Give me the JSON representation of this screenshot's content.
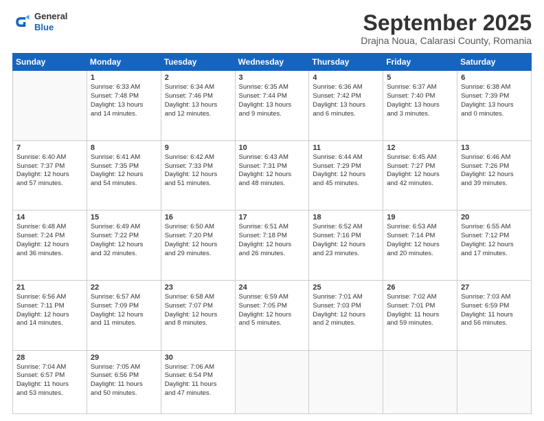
{
  "header": {
    "logo_general": "General",
    "logo_blue": "Blue",
    "month_title": "September 2025",
    "location": "Drajna Noua, Calarasi County, Romania"
  },
  "weekdays": [
    "Sunday",
    "Monday",
    "Tuesday",
    "Wednesday",
    "Thursday",
    "Friday",
    "Saturday"
  ],
  "weeks": [
    [
      {
        "day": "",
        "content": ""
      },
      {
        "day": "1",
        "content": "Sunrise: 6:33 AM\nSunset: 7:48 PM\nDaylight: 13 hours\nand 14 minutes."
      },
      {
        "day": "2",
        "content": "Sunrise: 6:34 AM\nSunset: 7:46 PM\nDaylight: 13 hours\nand 12 minutes."
      },
      {
        "day": "3",
        "content": "Sunrise: 6:35 AM\nSunset: 7:44 PM\nDaylight: 13 hours\nand 9 minutes."
      },
      {
        "day": "4",
        "content": "Sunrise: 6:36 AM\nSunset: 7:42 PM\nDaylight: 13 hours\nand 6 minutes."
      },
      {
        "day": "5",
        "content": "Sunrise: 6:37 AM\nSunset: 7:40 PM\nDaylight: 13 hours\nand 3 minutes."
      },
      {
        "day": "6",
        "content": "Sunrise: 6:38 AM\nSunset: 7:39 PM\nDaylight: 13 hours\nand 0 minutes."
      }
    ],
    [
      {
        "day": "7",
        "content": "Sunrise: 6:40 AM\nSunset: 7:37 PM\nDaylight: 12 hours\nand 57 minutes."
      },
      {
        "day": "8",
        "content": "Sunrise: 6:41 AM\nSunset: 7:35 PM\nDaylight: 12 hours\nand 54 minutes."
      },
      {
        "day": "9",
        "content": "Sunrise: 6:42 AM\nSunset: 7:33 PM\nDaylight: 12 hours\nand 51 minutes."
      },
      {
        "day": "10",
        "content": "Sunrise: 6:43 AM\nSunset: 7:31 PM\nDaylight: 12 hours\nand 48 minutes."
      },
      {
        "day": "11",
        "content": "Sunrise: 6:44 AM\nSunset: 7:29 PM\nDaylight: 12 hours\nand 45 minutes."
      },
      {
        "day": "12",
        "content": "Sunrise: 6:45 AM\nSunset: 7:27 PM\nDaylight: 12 hours\nand 42 minutes."
      },
      {
        "day": "13",
        "content": "Sunrise: 6:46 AM\nSunset: 7:26 PM\nDaylight: 12 hours\nand 39 minutes."
      }
    ],
    [
      {
        "day": "14",
        "content": "Sunrise: 6:48 AM\nSunset: 7:24 PM\nDaylight: 12 hours\nand 36 minutes."
      },
      {
        "day": "15",
        "content": "Sunrise: 6:49 AM\nSunset: 7:22 PM\nDaylight: 12 hours\nand 32 minutes."
      },
      {
        "day": "16",
        "content": "Sunrise: 6:50 AM\nSunset: 7:20 PM\nDaylight: 12 hours\nand 29 minutes."
      },
      {
        "day": "17",
        "content": "Sunrise: 6:51 AM\nSunset: 7:18 PM\nDaylight: 12 hours\nand 26 minutes."
      },
      {
        "day": "18",
        "content": "Sunrise: 6:52 AM\nSunset: 7:16 PM\nDaylight: 12 hours\nand 23 minutes."
      },
      {
        "day": "19",
        "content": "Sunrise: 6:53 AM\nSunset: 7:14 PM\nDaylight: 12 hours\nand 20 minutes."
      },
      {
        "day": "20",
        "content": "Sunrise: 6:55 AM\nSunset: 7:12 PM\nDaylight: 12 hours\nand 17 minutes."
      }
    ],
    [
      {
        "day": "21",
        "content": "Sunrise: 6:56 AM\nSunset: 7:11 PM\nDaylight: 12 hours\nand 14 minutes."
      },
      {
        "day": "22",
        "content": "Sunrise: 6:57 AM\nSunset: 7:09 PM\nDaylight: 12 hours\nand 11 minutes."
      },
      {
        "day": "23",
        "content": "Sunrise: 6:58 AM\nSunset: 7:07 PM\nDaylight: 12 hours\nand 8 minutes."
      },
      {
        "day": "24",
        "content": "Sunrise: 6:59 AM\nSunset: 7:05 PM\nDaylight: 12 hours\nand 5 minutes."
      },
      {
        "day": "25",
        "content": "Sunrise: 7:01 AM\nSunset: 7:03 PM\nDaylight: 12 hours\nand 2 minutes."
      },
      {
        "day": "26",
        "content": "Sunrise: 7:02 AM\nSunset: 7:01 PM\nDaylight: 11 hours\nand 59 minutes."
      },
      {
        "day": "27",
        "content": "Sunrise: 7:03 AM\nSunset: 6:59 PM\nDaylight: 11 hours\nand 56 minutes."
      }
    ],
    [
      {
        "day": "28",
        "content": "Sunrise: 7:04 AM\nSunset: 6:57 PM\nDaylight: 11 hours\nand 53 minutes."
      },
      {
        "day": "29",
        "content": "Sunrise: 7:05 AM\nSunset: 6:56 PM\nDaylight: 11 hours\nand 50 minutes."
      },
      {
        "day": "30",
        "content": "Sunrise: 7:06 AM\nSunset: 6:54 PM\nDaylight: 11 hours\nand 47 minutes."
      },
      {
        "day": "",
        "content": ""
      },
      {
        "day": "",
        "content": ""
      },
      {
        "day": "",
        "content": ""
      },
      {
        "day": "",
        "content": ""
      }
    ]
  ]
}
